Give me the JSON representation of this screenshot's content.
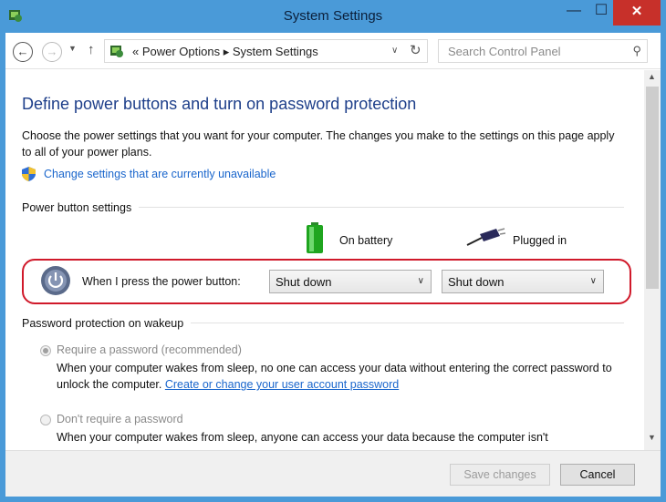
{
  "window": {
    "title": "System Settings",
    "controls": {
      "minimize": "—",
      "maximize": "☐",
      "close": "✕"
    }
  },
  "address_bar": {
    "breadcrumb": "« Power Options ▸ System Settings",
    "search_placeholder": "Search Control Panel"
  },
  "page": {
    "heading": "Define power buttons and turn on password protection",
    "description": "Choose the power settings that you want for your computer. The changes you make to the settings on this page apply to all of your power plans.",
    "admin_link": "Change settings that are currently unavailable",
    "power_section": {
      "label": "Power button settings",
      "columns": {
        "battery": "On battery",
        "plugged": "Plugged in"
      },
      "row_label": "When I press the power button:",
      "battery_value": "Shut down",
      "plugged_value": "Shut down"
    },
    "password_section": {
      "label": "Password protection on wakeup",
      "options": [
        {
          "label": "Require a password (recommended)",
          "checked": true,
          "text": "When your computer wakes from sleep, no one can access your data without entering the correct password to unlock the computer.",
          "link": "Create or change your user account password"
        },
        {
          "label": "Don't require a password",
          "checked": false,
          "text": "When your computer wakes from sleep, anyone can access your data because the computer isn't"
        }
      ]
    }
  },
  "footer": {
    "save_label": "Save changes",
    "cancel_label": "Cancel"
  },
  "colors": {
    "titlebar": "#4a9ad8",
    "close_button": "#c7302a",
    "heading": "#1e3f8a",
    "link": "#1a66cc",
    "highlight_ring": "#d0192a"
  }
}
